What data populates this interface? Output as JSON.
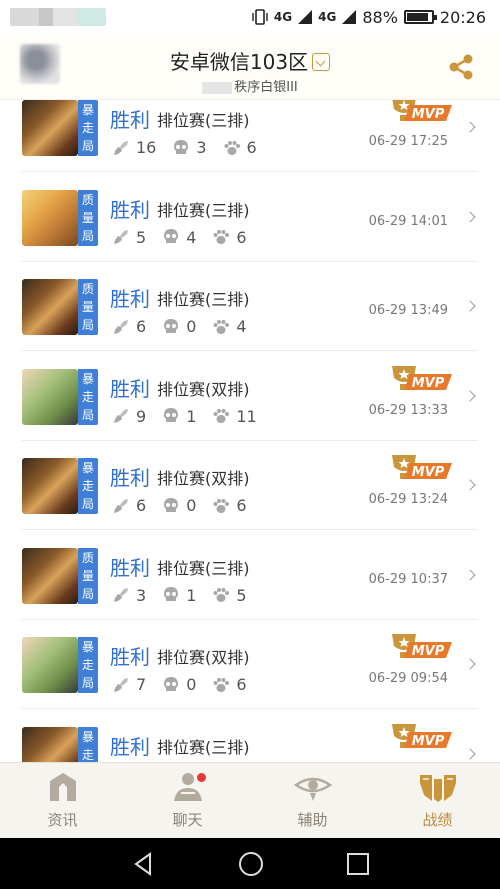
{
  "status_bar": {
    "network1": "4G",
    "network2": "4G",
    "battery_percent": "88%",
    "battery_level": 0.88,
    "time": "20:26"
  },
  "header": {
    "title": "安卓微信103区",
    "subtitle": "秩序白银III"
  },
  "matches": [
    {
      "result": "胜利",
      "mode": "暴走局",
      "type": "排位赛(三排)",
      "kills": "16",
      "deaths": "3",
      "assists": "6",
      "time": "06-29 17:25",
      "mvp": true,
      "mvp_label": "MVP",
      "hero": "a"
    },
    {
      "result": "胜利",
      "mode": "质量局",
      "type": "排位赛(三排)",
      "kills": "5",
      "deaths": "4",
      "assists": "6",
      "time": "06-29 14:01",
      "mvp": false,
      "hero": "b"
    },
    {
      "result": "胜利",
      "mode": "质量局",
      "type": "排位赛(三排)",
      "kills": "6",
      "deaths": "0",
      "assists": "4",
      "time": "06-29 13:49",
      "mvp": false,
      "hero": "a"
    },
    {
      "result": "胜利",
      "mode": "暴走局",
      "type": "排位赛(双排)",
      "kills": "9",
      "deaths": "1",
      "assists": "11",
      "time": "06-29 13:33",
      "mvp": true,
      "mvp_label": "MVP",
      "hero": "c"
    },
    {
      "result": "胜利",
      "mode": "暴走局",
      "type": "排位赛(双排)",
      "kills": "6",
      "deaths": "0",
      "assists": "6",
      "time": "06-29 13:24",
      "mvp": true,
      "mvp_label": "MVP",
      "hero": "a"
    },
    {
      "result": "胜利",
      "mode": "质量局",
      "type": "排位赛(三排)",
      "kills": "3",
      "deaths": "1",
      "assists": "5",
      "time": "06-29 10:37",
      "mvp": false,
      "hero": "a"
    },
    {
      "result": "胜利",
      "mode": "暴走局",
      "type": "排位赛(双排)",
      "kills": "7",
      "deaths": "0",
      "assists": "6",
      "time": "06-29 09:54",
      "mvp": true,
      "mvp_label": "MVP",
      "hero": "c"
    },
    {
      "result": "胜利",
      "mode": "暴走局",
      "type": "排位赛(三排)",
      "kills": "",
      "deaths": "",
      "assists": "",
      "time": "",
      "mvp": true,
      "mvp_label": "MVP",
      "hero": "a"
    }
  ],
  "bottom_nav": [
    {
      "label": "资讯",
      "icon": "news-icon",
      "active": false
    },
    {
      "label": "聊天",
      "icon": "chat-icon",
      "active": false,
      "badge": true
    },
    {
      "label": "辅助",
      "icon": "assist-icon",
      "active": false
    },
    {
      "label": "战绩",
      "icon": "record-icon",
      "active": true
    }
  ],
  "colors": {
    "accent_gold": "#b98c3e",
    "win_blue": "#2f6fd0",
    "mode_tag_blue": "#3f7fd6",
    "mvp_gold": "#c9963c",
    "badge_red": "#e53935"
  }
}
